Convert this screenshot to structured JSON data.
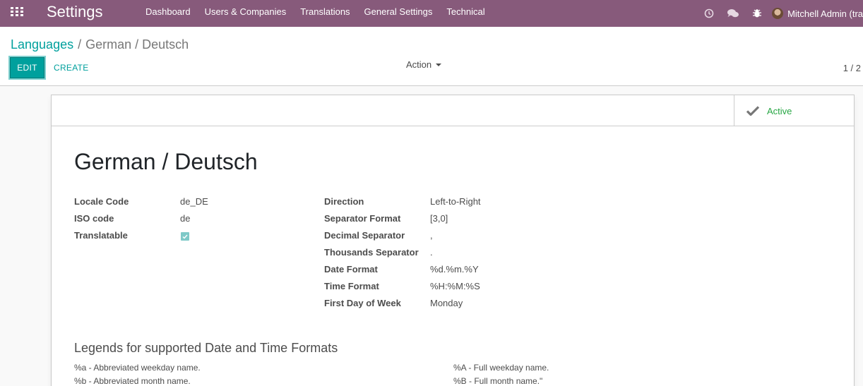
{
  "navbar": {
    "app_title": "Settings",
    "menu": [
      "Dashboard",
      "Users & Companies",
      "Translations",
      "General Settings",
      "Technical"
    ],
    "user_label": "Mitchell Admin (tra",
    "icons": [
      "apps-grid-icon",
      "clock-icon",
      "chat-icon",
      "bug-icon"
    ]
  },
  "breadcrumb": {
    "parent": "Languages",
    "separator": "/",
    "current": "German / Deutsch"
  },
  "buttons": {
    "edit": "EDIT",
    "create": "CREATE",
    "action": "Action"
  },
  "pager": "1 / 2",
  "status_button": {
    "label": "Active",
    "icon": "check-icon"
  },
  "record": {
    "title": "German / Deutsch",
    "left_fields": [
      {
        "label": "Locale Code",
        "value": "de_DE"
      },
      {
        "label": "ISO code",
        "value": "de"
      },
      {
        "label": "Translatable",
        "value": "",
        "checked": true
      }
    ],
    "right_fields": [
      {
        "label": "Direction",
        "value": "Left-to-Right"
      },
      {
        "label": "Separator Format",
        "value": "[3,0]"
      },
      {
        "label": "Decimal Separator",
        "value": ","
      },
      {
        "label": "Thousands Separator",
        "value": "."
      },
      {
        "label": "Date Format",
        "value": "%d.%m.%Y"
      },
      {
        "label": "Time Format",
        "value": "%H:%M:%S"
      },
      {
        "label": "First Day of Week",
        "value": "Monday"
      }
    ]
  },
  "legends": {
    "title": "Legends for supported Date and Time Formats",
    "left": [
      "%a - Abbreviated weekday name.",
      "%b - Abbreviated month name."
    ],
    "right": [
      "%A - Full weekday name.",
      "%B - Full month name.\""
    ]
  },
  "colors": {
    "navbar": "#875a7b",
    "accent": "#00a09d",
    "active": "#28a745"
  }
}
